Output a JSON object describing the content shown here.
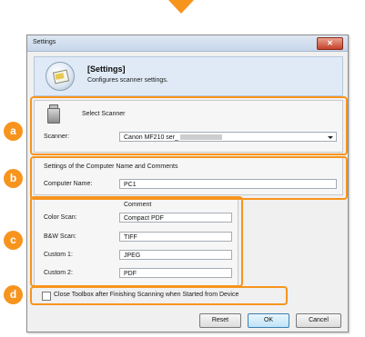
{
  "window": {
    "title": "Settings",
    "close_symbol": "✕"
  },
  "header": {
    "title": "[Settings]",
    "subtitle": "Configures scanner settings."
  },
  "select_scanner": {
    "heading": "Select Scanner",
    "label": "Scanner:",
    "value": "Canon MF210 ser_"
  },
  "computer_name": {
    "heading": "Settings of the Computer Name and Comments",
    "label": "Computer Name:",
    "value": "PC1"
  },
  "comments": {
    "heading": "Comment",
    "rows": [
      {
        "label": "Color Scan:",
        "value": "Compact PDF"
      },
      {
        "label": "B&W Scan:",
        "value": "TIFF"
      },
      {
        "label": "Custom 1:",
        "value": "JPEG"
      },
      {
        "label": "Custom 2:",
        "value": "PDF"
      }
    ]
  },
  "close_toolbox": {
    "label": "Close Toolbox after Finishing Scanning when Started from Device",
    "checked": false
  },
  "buttons": {
    "reset": "Reset",
    "ok": "OK",
    "cancel": "Cancel"
  },
  "callouts": {
    "a": "a",
    "b": "b",
    "c": "c",
    "d": "d"
  },
  "colors": {
    "accent": "#f7941d",
    "header_bg": "#dfeaf6",
    "window_bg": "#f0f0f0"
  }
}
